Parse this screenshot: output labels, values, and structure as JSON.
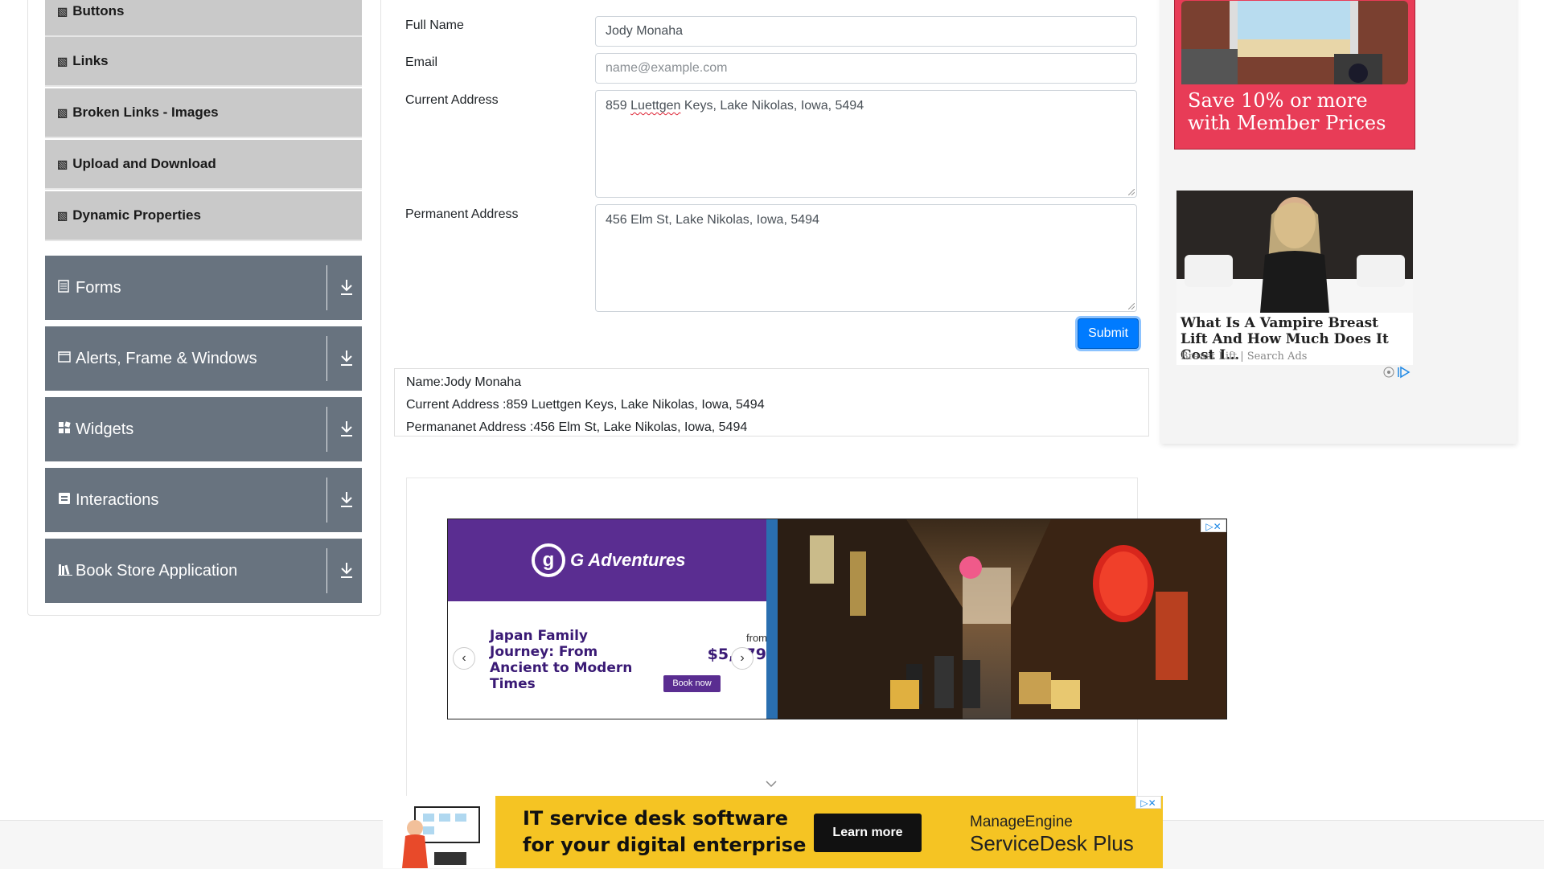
{
  "sidebar": {
    "sub_items": [
      {
        "label": "Buttons"
      },
      {
        "label": "Links"
      },
      {
        "label": "Broken Links - Images"
      },
      {
        "label": "Upload and Download"
      },
      {
        "label": "Dynamic Properties"
      }
    ],
    "groups": [
      {
        "label": "Forms",
        "icon": "form-icon"
      },
      {
        "label": "Alerts, Frame & Windows",
        "icon": "window-icon"
      },
      {
        "label": "Widgets",
        "icon": "widgets-icon"
      },
      {
        "label": "Interactions",
        "icon": "interactions-icon"
      },
      {
        "label": "Book Store Application",
        "icon": "book-icon"
      }
    ]
  },
  "form": {
    "full_name_label": "Full Name",
    "full_name_value": "Jody Monaha",
    "email_label": "Email",
    "email_placeholder": "name@example.com",
    "current_address_label": "Current Address",
    "current_address_prefix": "859 ",
    "current_address_misspelled": "Luettgen",
    "current_address_suffix": " Keys, Lake Nikolas, Iowa, 5494",
    "permanent_address_label": "Permanent Address",
    "permanent_address_value": "456 Elm St, Lake Nikolas, Iowa, 5494",
    "submit_label": "Submit"
  },
  "output": {
    "name_line": "Name:Jody Monaha",
    "current_line": "Current Address :859 Luettgen Keys, Lake Nikolas, Iowa, 5494",
    "permanent_line": "Permananet Address :456 Elm St, Lake Nikolas, Iowa, 5494"
  },
  "ads": {
    "g_adventures": {
      "brand": "G Adventures",
      "title": "Japan Family Journey: From Ancient to Modern Times",
      "from_label": "from",
      "price": "$5,079",
      "cta": "Book now"
    },
    "right_top": {
      "promo": "Save 10% or more with Member Prices",
      "accent": "#e83c57"
    },
    "right_bottom": {
      "title": "What Is A Vampire Breast Lift And How Much Does It Cost I…",
      "source": "Breast Lift | Search Ads"
    },
    "bottom_banner": {
      "headline_line1": "IT service desk software",
      "headline_line2": "for your digital enterprise",
      "cta": "Learn more",
      "brand": "ManageEngine",
      "product": "ServiceDesk Plus",
      "accent": "#f5c423"
    }
  },
  "colors": {
    "sidebar_group_bg": "#68737f",
    "sidebar_item_bg": "#c9c9c9",
    "submit_bg": "#007bff"
  }
}
